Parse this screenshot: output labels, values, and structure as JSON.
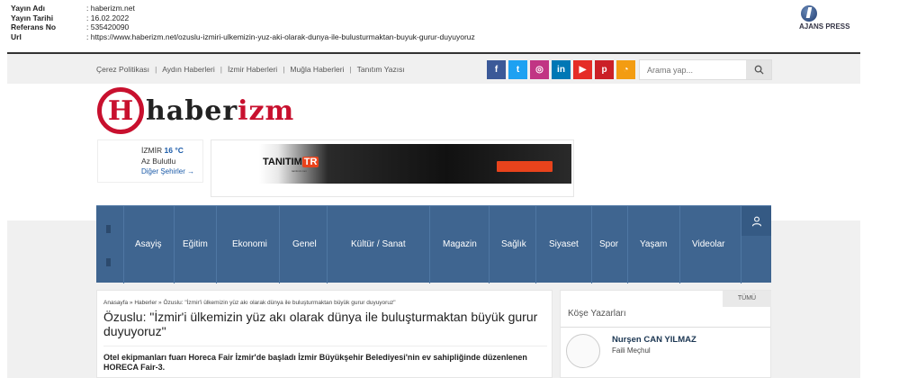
{
  "clipping": {
    "rows": [
      {
        "key": "Yayın Adı",
        "value": ": haberizm.net"
      },
      {
        "key": "Yayın Tarihi",
        "value": ": 16.02.2022"
      },
      {
        "key": "Referans No",
        "value": ": 535420090"
      },
      {
        "key": "Url",
        "value": ": https://www.haberizm.net/ozuslu-izmiri-ulkemizin-yuz-aki-olarak-dunya-ile-bulusturmaktan-buyuk-gurur-duyuyoruz"
      }
    ],
    "agency": "AJANS PRESS"
  },
  "topbar": {
    "links": [
      "Çerez Politikası",
      "Aydın Haberleri",
      "İzmir Haberleri",
      "Muğla Haberleri",
      "Tanıtım Yazısı"
    ],
    "social": [
      {
        "icon": "facebook-icon",
        "glyph": "f",
        "color": "#3b5998"
      },
      {
        "icon": "twitter-icon",
        "glyph": "t",
        "color": "#1da1f2"
      },
      {
        "icon": "instagram-icon",
        "glyph": "◎",
        "color": "#c13584"
      },
      {
        "icon": "linkedin-icon",
        "glyph": "in",
        "color": "#0077b5"
      },
      {
        "icon": "youtube-icon",
        "glyph": "▶",
        "color": "#e52d27"
      },
      {
        "icon": "pinterest-icon",
        "glyph": "p",
        "color": "#cb2027"
      },
      {
        "icon": "rss-icon",
        "glyph": "◔",
        "color": "#f39c12"
      }
    ],
    "search_placeholder": "Arama yap..."
  },
  "logo": {
    "letter": "H",
    "part1": "haber",
    "part2": "izm"
  },
  "weather": {
    "city": "İZMİR",
    "temp": "16 °C",
    "desc": "Az Bulutlu",
    "more": "Diğer Şehirler →"
  },
  "banner": {
    "brand": "TANITIM",
    "tr": "TR",
    "sub": "tanitimtr.com"
  },
  "nav": {
    "items": [
      "Asayiş",
      "Eğitim",
      "Ekonomi",
      "Genel",
      "Kültür / Sanat",
      "Magazin",
      "Sağlık",
      "Siyaset",
      "Spor",
      "Yaşam",
      "Videolar"
    ]
  },
  "article": {
    "breadcrumb": "Anasayfa » Haberler » Özuslu: \"İzmir'i ülkemizin yüz akı olarak dünya ile buluşturmaktan büyük gurur duyuyoruz\"",
    "title": "Özuslu: \"İzmir'i ülkemizin yüz akı olarak dünya ile buluşturmaktan büyük gurur duyuyoruz\"",
    "lede": "Otel ekipmanları fuarı Horeca Fair İzmir'de başladı   İzmir Büyükşehir Belediyesi'nin ev sahipliğinde düzenlenen HORECA Fair-3."
  },
  "sidebar": {
    "all_label": "TÜMÜ",
    "title": "Köşe Yazarları",
    "author_name": "Nurşen CAN YILMAZ",
    "author_sub": "Faili Meçhul"
  }
}
